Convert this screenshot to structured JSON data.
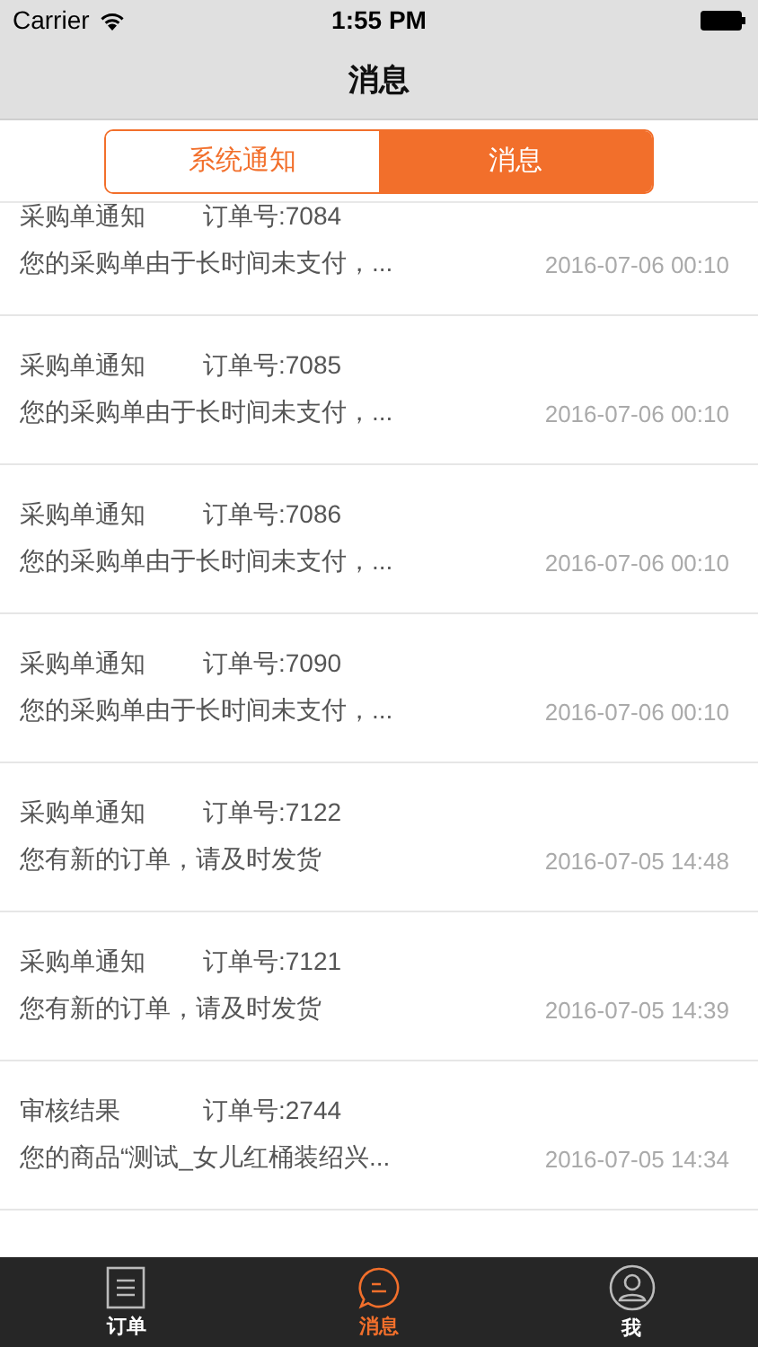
{
  "status_bar": {
    "carrier": "Carrier",
    "time": "1:55 PM"
  },
  "nav": {
    "title": "消息"
  },
  "segments": [
    {
      "label": "系统通知",
      "selected": false
    },
    {
      "label": "消息",
      "selected": true
    }
  ],
  "messages": [
    {
      "type": "采购单通知",
      "order": "订单号:7084",
      "text": "您的采购单由于长时间未支付，...",
      "time": "2016-07-06 00:10"
    },
    {
      "type": "采购单通知",
      "order": "订单号:7085",
      "text": "您的采购单由于长时间未支付，...",
      "time": "2016-07-06 00:10"
    },
    {
      "type": "采购单通知",
      "order": "订单号:7086",
      "text": "您的采购单由于长时间未支付，...",
      "time": "2016-07-06 00:10"
    },
    {
      "type": "采购单通知",
      "order": "订单号:7090",
      "text": "您的采购单由于长时间未支付，...",
      "time": "2016-07-06 00:10"
    },
    {
      "type": "采购单通知",
      "order": "订单号:7122",
      "text": "您有新的订单，请及时发货",
      "time": "2016-07-05 14:48"
    },
    {
      "type": "采购单通知",
      "order": "订单号:7121",
      "text": "您有新的订单，请及时发货",
      "time": "2016-07-05 14:39"
    },
    {
      "type": "审核结果",
      "order": "订单号:2744",
      "text": "您的商品“测试_女儿红桶装绍兴...",
      "time": "2016-07-05 14:34"
    }
  ],
  "tab_bar": [
    {
      "kind": "orders",
      "label": "订单",
      "selected": false
    },
    {
      "kind": "messages",
      "label": "消息",
      "selected": true
    },
    {
      "kind": "me",
      "label": "我",
      "selected": false
    }
  ]
}
